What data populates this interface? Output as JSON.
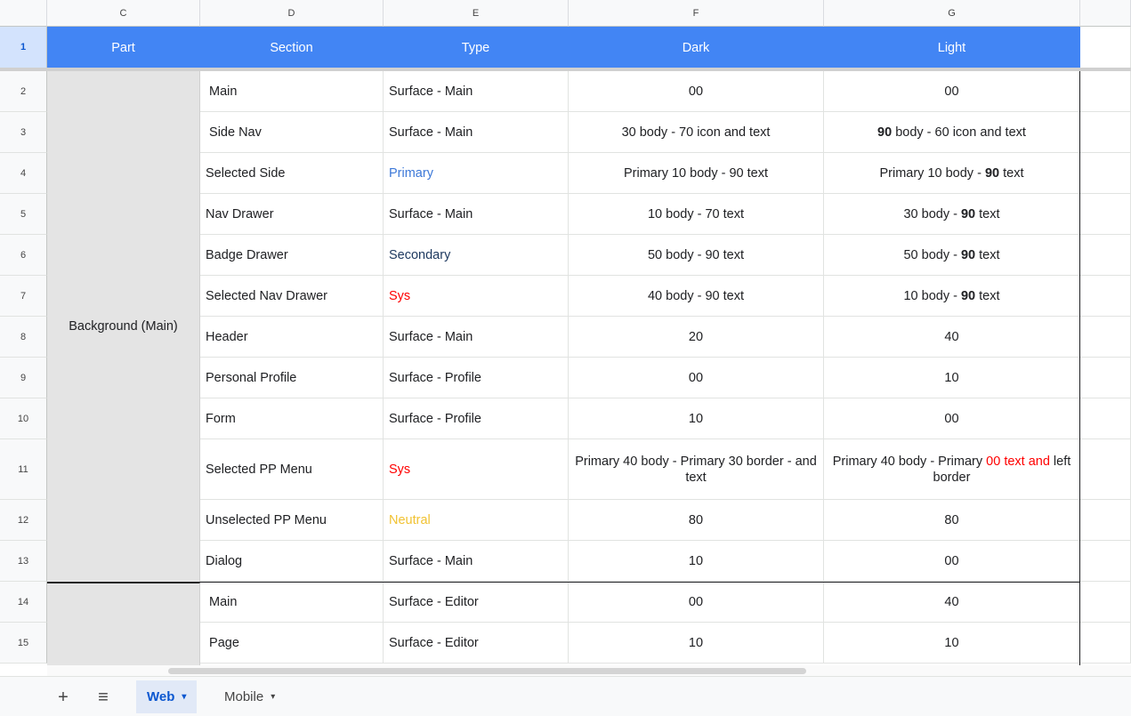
{
  "columns": [
    "C",
    "D",
    "E",
    "F",
    "G"
  ],
  "header_row_number": "1",
  "header": {
    "part": "Part",
    "section": "Section",
    "type": "Type",
    "dark": "Dark",
    "light": "Light"
  },
  "merged_part_label": "Background (Main)",
  "rows": [
    {
      "num": "2",
      "section": " Main",
      "type": "Surface - Main",
      "type_style": "",
      "dark": "00",
      "light": "00"
    },
    {
      "num": "3",
      "section": " Side Nav",
      "type": "Surface - Main",
      "type_style": "",
      "dark": "30 body - 70 icon and text",
      "light": "90 body - 60 icon and text"
    },
    {
      "num": "4",
      "section": "Selected Side",
      "type": "Primary",
      "type_style": "primary",
      "dark": "Primary 10 body - 90 text",
      "light": "Primary 10 body - 90 text"
    },
    {
      "num": "5",
      "section": "Nav Drawer",
      "type": "Surface - Main",
      "type_style": "",
      "dark": "10 body - 70 text",
      "light": "30 body - 90 text"
    },
    {
      "num": "6",
      "section": "Badge Drawer",
      "type": "Secondary",
      "type_style": "secondary",
      "dark": "50 body - 90 text",
      "light": "50 body - 90 text"
    },
    {
      "num": "7",
      "section": "Selected Nav Drawer",
      "type": "Sys",
      "type_style": "sys",
      "dark": "40 body - 90 text",
      "light": "10 body - 90 text"
    },
    {
      "num": "8",
      "section": "Header",
      "type": "Surface - Main",
      "type_style": "",
      "dark": "20",
      "light": "40"
    },
    {
      "num": "9",
      "section": "Personal Profile",
      "type": "Surface - Profile",
      "type_style": "",
      "dark": "00",
      "light": "10"
    },
    {
      "num": "10",
      "section": "Form",
      "type": "Surface - Profile",
      "type_style": "",
      "dark": "10",
      "light": "00"
    },
    {
      "num": "11",
      "section": "Selected PP Menu",
      "type": "Sys",
      "type_style": "sys",
      "dark": "Primary 40 body - Primary 30 border - and text",
      "light": "Primary 40 body - Primary 00 text and left border"
    },
    {
      "num": "12",
      "section": "Unselected PP Menu",
      "type": "Neutral",
      "type_style": "neutral",
      "dark": "80",
      "light": "80"
    },
    {
      "num": "13",
      "section": "Dialog",
      "type": "Surface - Main",
      "type_style": "",
      "dark": "10",
      "light": "00"
    },
    {
      "num": "14",
      "section": " Main",
      "type": "Surface - Editor",
      "type_style": "",
      "dark": "00",
      "light": "40"
    },
    {
      "num": "15",
      "section": " Page",
      "type": "Surface - Editor",
      "type_style": "",
      "dark": "10",
      "light": "10"
    }
  ],
  "rich_light": {
    "3": {
      "bold": "90",
      "rest": " body - 60 icon and text"
    },
    "4": {
      "pre": "Primary 10 body - ",
      "bold": "90",
      "post": " text"
    },
    "5": {
      "pre": "30 body - ",
      "bold": "90",
      "post": " text"
    },
    "6": {
      "pre": "50 body - ",
      "bold": "90",
      "post": " text"
    },
    "7": {
      "pre": "10 body - ",
      "bold": "90",
      "post": " text"
    },
    "11": {
      "pre": "Primary 40 body - Primary ",
      "red": "00 text and",
      "post": " left border"
    }
  },
  "tabbar": {
    "add_icon": "+",
    "menu_icon": "≡",
    "tabs": [
      {
        "label": "Web",
        "active": true
      },
      {
        "label": "Mobile",
        "active": false
      }
    ],
    "caret": "▾"
  },
  "colors": {
    "header_bg": "#4285f4",
    "merged_bg": "#e4e4e4",
    "primary": "#3c78d8",
    "sys": "#ff0000",
    "neutral": "#f1c232",
    "active_tab": "#0b57d0"
  }
}
